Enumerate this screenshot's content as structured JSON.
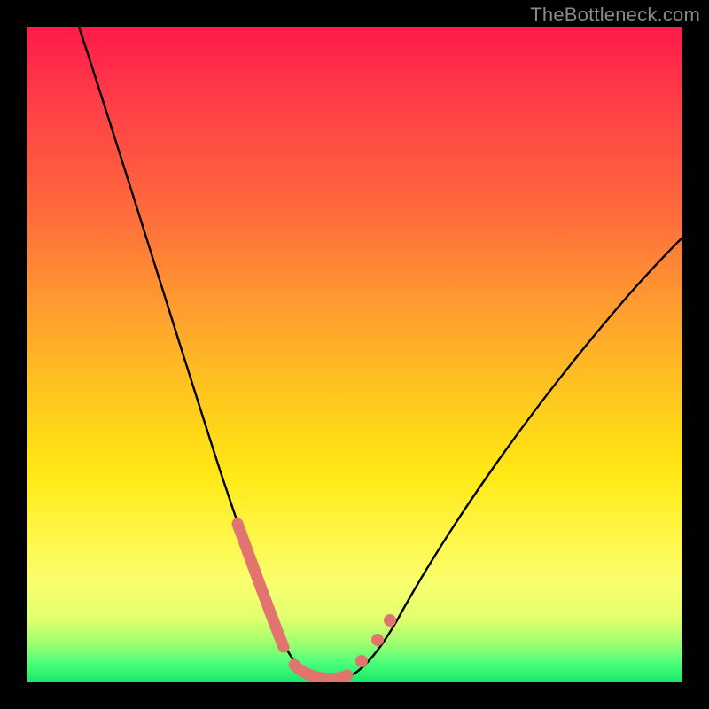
{
  "watermark": "TheBottleneck.com",
  "chart_data": {
    "type": "line",
    "title": "",
    "xlabel": "",
    "ylabel": "",
    "xlim": [
      0,
      100
    ],
    "ylim": [
      0,
      100
    ],
    "series": [
      {
        "name": "bottleneck-curve",
        "x": [
          8,
          12,
          16,
          20,
          24,
          28,
          30,
          32,
          34,
          36,
          38,
          40,
          42,
          44,
          46,
          48,
          52,
          56,
          60,
          66,
          74,
          84,
          96,
          100
        ],
        "y": [
          100,
          86,
          72,
          59,
          46,
          33,
          27,
          21,
          15,
          10,
          6,
          3,
          1,
          0,
          0,
          1,
          4,
          9,
          15,
          23,
          34,
          47,
          61,
          66
        ]
      }
    ],
    "markers": [
      {
        "name": "left-dense-segment",
        "x_range": [
          30,
          36
        ],
        "note": "pink thick overlay on descending branch"
      },
      {
        "name": "valley-floor",
        "x_range": [
          40,
          48
        ],
        "note": "pink thick overlay at minimum"
      },
      {
        "name": "right-dot-1",
        "x": 50,
        "y": 3
      },
      {
        "name": "right-dot-2",
        "x": 53,
        "y": 7
      },
      {
        "name": "right-dot-3",
        "x": 55,
        "y": 9
      }
    ],
    "colors": {
      "curve": "#000000",
      "marker": "#e2746f",
      "gradient_top": "#ff1a4b",
      "gradient_bottom": "#17e86a"
    }
  }
}
